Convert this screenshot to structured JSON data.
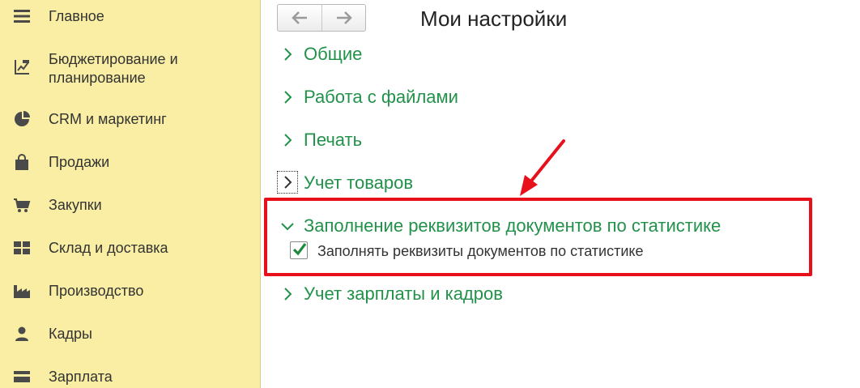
{
  "sidebar": {
    "items": [
      {
        "label": "Главное",
        "icon": "menu-lines-icon"
      },
      {
        "label": "Бюджетирование и",
        "label2": "планирование",
        "icon": "budget-chart-icon"
      },
      {
        "label": "CRM и маркетинг",
        "icon": "pie-chart-icon"
      },
      {
        "label": "Продажи",
        "icon": "shopping-bag-icon"
      },
      {
        "label": "Закупки",
        "icon": "shopping-cart-icon"
      },
      {
        "label": "Склад и доставка",
        "icon": "warehouse-grid-icon"
      },
      {
        "label": "Производство",
        "icon": "factory-icon"
      },
      {
        "label": "Кадры",
        "icon": "person-icon"
      },
      {
        "label": "Зарплата",
        "icon": "wallet-icon"
      }
    ]
  },
  "header": {
    "title": "Мои настройки"
  },
  "sections": [
    {
      "label": "Общие",
      "expanded": false
    },
    {
      "label": "Работа с файлами",
      "expanded": false
    },
    {
      "label": "Печать",
      "expanded": false
    },
    {
      "label": "Учет товаров",
      "expanded": false,
      "focused": true
    },
    {
      "label": "Заполнение реквизитов документов по статистике",
      "expanded": true
    },
    {
      "label": "Учет зарплаты и кадров",
      "expanded": false
    }
  ],
  "checkbox": {
    "label": "Заполнять реквизиты документов по статистике",
    "checked": true
  },
  "colors": {
    "sidebar_bg": "#f9eea4",
    "section_text": "#22914a",
    "highlight": "#e8101a"
  }
}
